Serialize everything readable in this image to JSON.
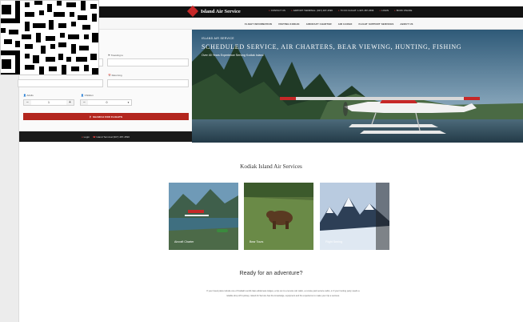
{
  "brand": {
    "name": "Island Air Service"
  },
  "utility_links": [
    "CONTACT US",
    "AIRPORT TERMINAL: (907) 487-4596",
    "TO KO FLIGHT: 1-907-487-4596",
    "LOGIN",
    "BOOK ONLINE"
  ],
  "nav": [
    "FLIGHT INFORMATION",
    "VISITING KODIAK",
    "AIRCRAFT CHARTER",
    "AIR CARGO",
    "FLIGHT SUPPORT SERVICES",
    "ABOUT US"
  ],
  "search": {
    "returning_label": "Returning",
    "adults_label": "Adults",
    "adults_value": "1",
    "children_label": "Children",
    "children_value": "0",
    "button_label": "SEARCH FOR FLIGHTS",
    "footer_login": "Login",
    "footer_phone": "Island Terminal (907) 487-4596"
  },
  "hero": {
    "kicker": "ISLAND AIR SERVICE",
    "title": "SCHEDULED SERVICE, AIR CHARTERS, BEAR VIEWING, HUNTING, FISHING",
    "subtitle": "Over 40 Years Experience Serving Kodiak Island"
  },
  "services": {
    "heading": "Kodiak Island Air Services",
    "cards": [
      {
        "label": "Aircraft Charter",
        "icon": "floatplane-photo"
      },
      {
        "label": "Bear Tours",
        "icon": "bear-photo"
      },
      {
        "label": "Flight Seeing",
        "icon": "mountains-photo"
      }
    ]
  },
  "adventure": {
    "heading": "Ready for an adventure?",
    "body": "If your travel plans include one of Kodiak's world class wilderness lodges, a trip out to a remote cub cabin, a remote park service cabin, or if your hunting party needs a reliable drop off & pickup, Island Air Service has the knowledge, equipment and the experience to make your trip a success."
  },
  "colors": {
    "accent": "#b3261e",
    "topbar": "#121212",
    "nav_bg": "#f7f7f7"
  }
}
